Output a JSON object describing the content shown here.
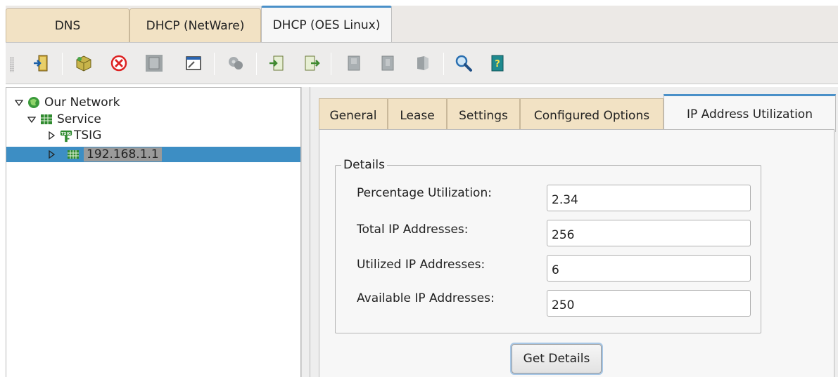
{
  "top_tabs": [
    {
      "label": "DNS"
    },
    {
      "label": "DHCP (NetWare)"
    },
    {
      "label": "DHCP (OES Linux)"
    }
  ],
  "toolbar": {
    "buttons": [
      {
        "icon": "exit-door-icon"
      },
      {
        "icon": "create-box-icon"
      },
      {
        "icon": "delete-icon"
      },
      {
        "icon": "disabled-server-icon"
      },
      {
        "icon": "window-properties-icon"
      },
      {
        "icon": "disabled-gears-icon"
      },
      {
        "icon": "import-icon"
      },
      {
        "icon": "export-icon"
      },
      {
        "icon": "disabled-page-icon-1"
      },
      {
        "icon": "disabled-page-icon-2"
      },
      {
        "icon": "disabled-server-3d-icon"
      },
      {
        "icon": "search-icon"
      },
      {
        "icon": "help-book-icon"
      }
    ]
  },
  "tree": {
    "items": [
      {
        "label": "Our Network",
        "icon": "globe-icon",
        "expanded": true
      },
      {
        "label": "Service",
        "icon": "service-grid-icon",
        "expanded": true
      },
      {
        "label": "TSIG",
        "icon": "tsig-key-icon",
        "expanded": false
      },
      {
        "label": "192.168.1.1",
        "icon": "subnet-icon",
        "expanded": false,
        "selected": true
      }
    ],
    "tsig_icon_text": "TSIG"
  },
  "inner_tabs": [
    {
      "label": "General"
    },
    {
      "label": "Lease"
    },
    {
      "label": "Settings"
    },
    {
      "label": "Configured Options"
    },
    {
      "label": "IP Address Utilization",
      "active": true
    }
  ],
  "details": {
    "legend": "Details",
    "fields": [
      {
        "label": "Percentage Utilization:",
        "value": "2.34"
      },
      {
        "label": "Total IP Addresses:",
        "value": "256"
      },
      {
        "label": "Utilized IP Addresses:",
        "value": "6"
      },
      {
        "label": "Available IP Addresses:",
        "value": "250"
      }
    ],
    "button_label": "Get Details"
  },
  "colors": {
    "tab_inactive": "#f2e2c4",
    "tab_active_border": "#4a90c8",
    "selection": "#3d8ec4"
  }
}
